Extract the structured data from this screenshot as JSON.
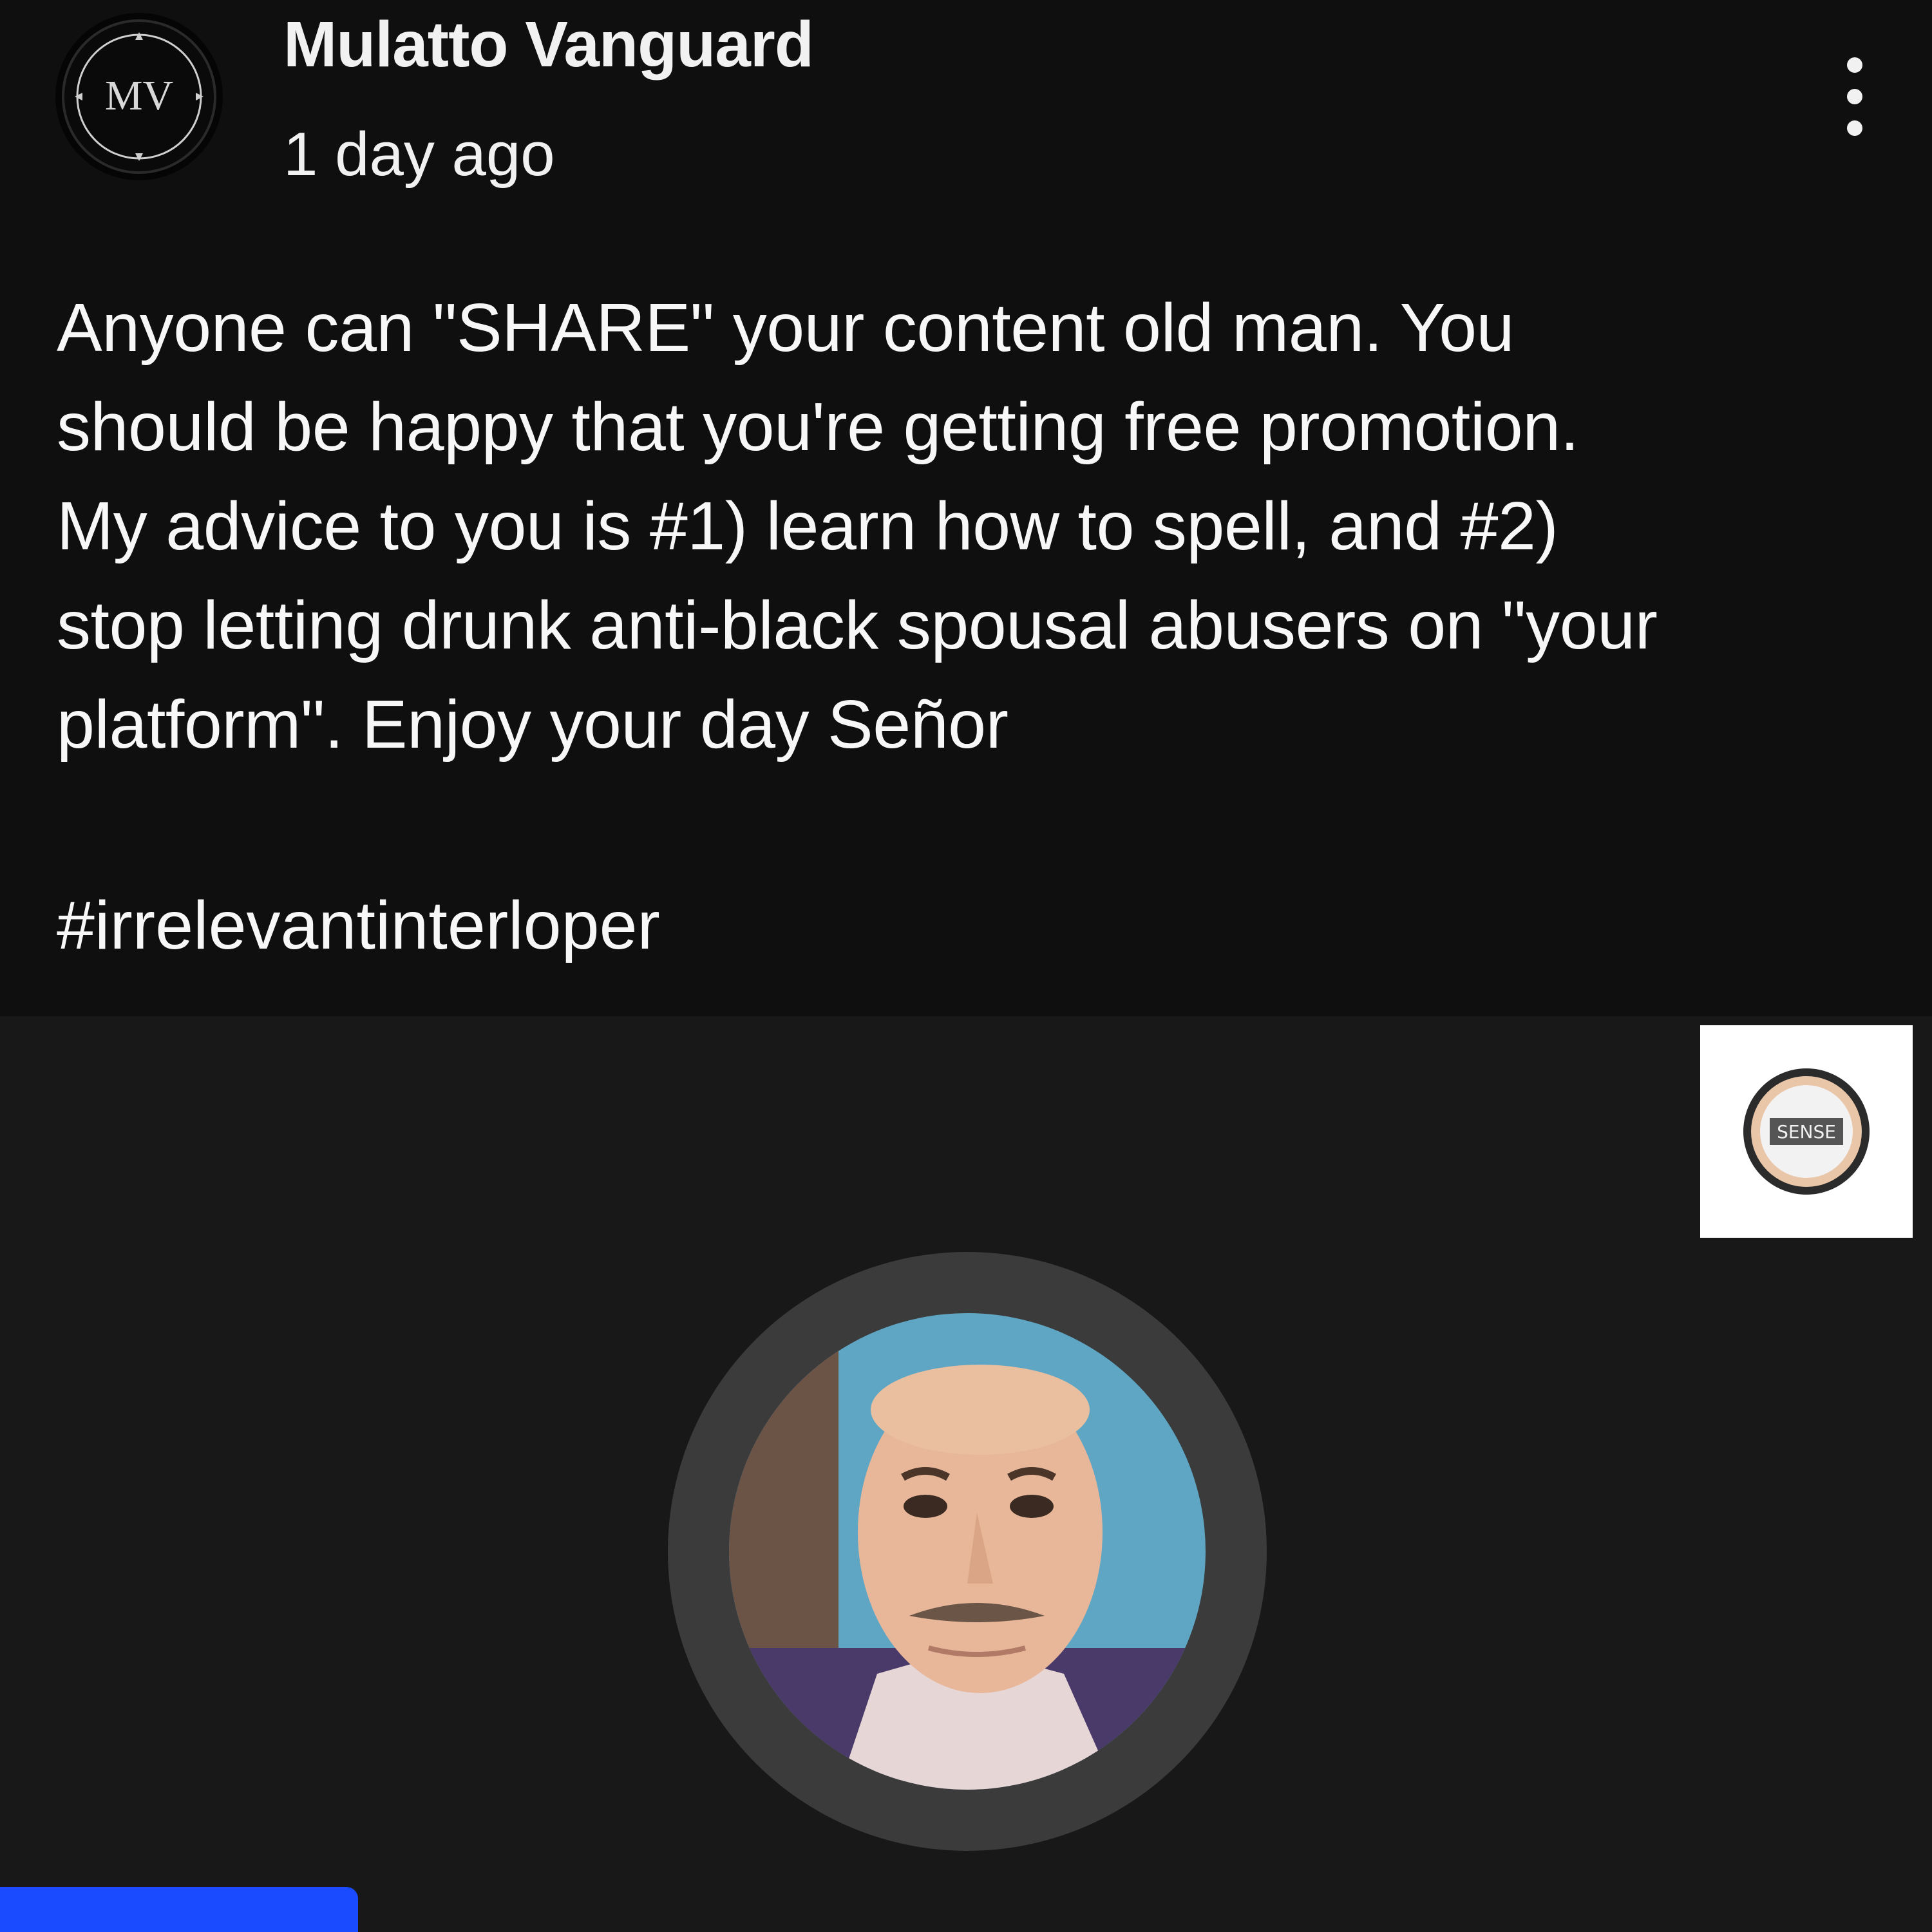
{
  "post": {
    "author": {
      "name": "Mulatto Vanguard",
      "avatar_text": "MV",
      "avatar_icon": "compass-logo-icon"
    },
    "timestamp": "1 day ago",
    "menu_icon": "more-vertical-icon",
    "body_lines": [
      "Anyone can \"SHARE\" your content old man. You",
      "should be happy that you're getting free promotion.",
      "My advice to you is #1) learn how to spell, and #2)",
      "stop letting drunk anti-black spousal abusers on \"your",
      "platform\". Enjoy your day Señor"
    ],
    "hashtag": "#irrelevantinterloper"
  },
  "media": {
    "badge_icon": "channel-logo-icon",
    "badge_text": "SENSE",
    "portrait_icon": "portrait-photo",
    "colors": {
      "background": "#181818",
      "ring": "#3b3b3b",
      "accent_bar": "#1a4bff"
    }
  },
  "colors": {
    "page_background": "#0f0f0f",
    "text": "#f1f1f1"
  }
}
